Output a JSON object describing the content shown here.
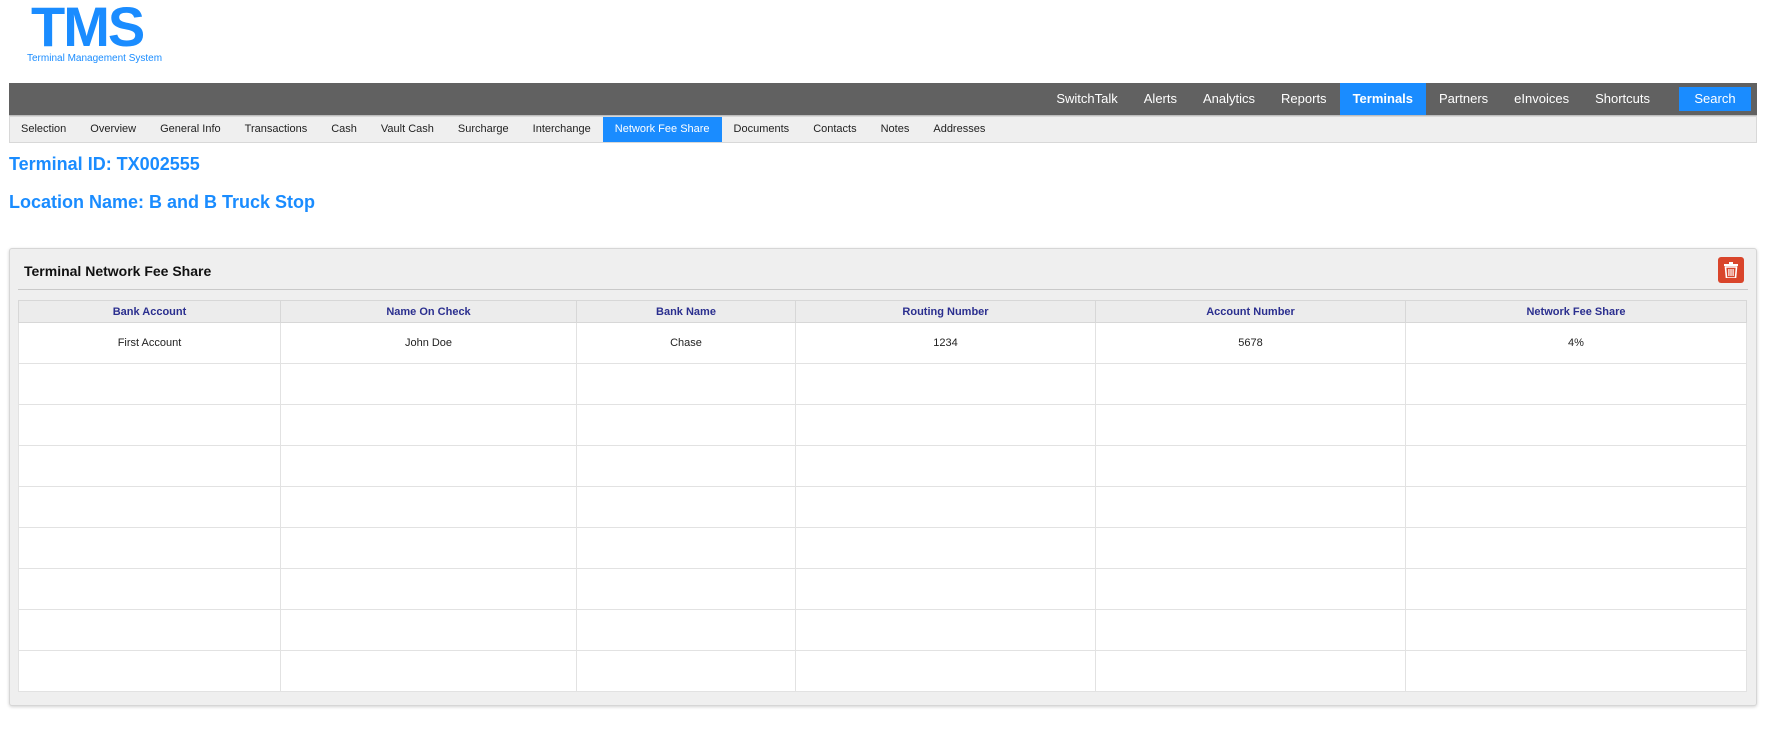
{
  "logo": {
    "mark": "TMS",
    "subtitle": "Terminal Management System"
  },
  "topnav": {
    "items": [
      {
        "label": "SwitchTalk",
        "active": false
      },
      {
        "label": "Alerts",
        "active": false
      },
      {
        "label": "Analytics",
        "active": false
      },
      {
        "label": "Reports",
        "active": false
      },
      {
        "label": "Terminals",
        "active": true
      },
      {
        "label": "Partners",
        "active": false
      },
      {
        "label": "eInvoices",
        "active": false
      },
      {
        "label": "Shortcuts",
        "active": false
      }
    ],
    "search_label": "Search"
  },
  "subnav": {
    "items": [
      {
        "label": "Selection",
        "active": false
      },
      {
        "label": "Overview",
        "active": false
      },
      {
        "label": "General Info",
        "active": false
      },
      {
        "label": "Transactions",
        "active": false
      },
      {
        "label": "Cash",
        "active": false
      },
      {
        "label": "Vault Cash",
        "active": false
      },
      {
        "label": "Surcharge",
        "active": false
      },
      {
        "label": "Interchange",
        "active": false
      },
      {
        "label": "Network Fee Share",
        "active": true
      },
      {
        "label": "Documents",
        "active": false
      },
      {
        "label": "Contacts",
        "active": false
      },
      {
        "label": "Notes",
        "active": false
      },
      {
        "label": "Addresses",
        "active": false
      }
    ]
  },
  "terminal": {
    "id_text": "Terminal ID: TX002555",
    "location_text": "Location Name: B and B Truck Stop"
  },
  "panel": {
    "title": "Terminal Network Fee Share",
    "delete_icon": "trash-icon",
    "columns": [
      "Bank Account",
      "Name On Check",
      "Bank Name",
      "Routing Number",
      "Account Number",
      "Network Fee Share"
    ],
    "rows": [
      [
        "First Account",
        "John Doe",
        "Chase",
        "1234",
        "5678",
        "4%"
      ],
      [
        "",
        "",
        "",
        "",
        "",
        ""
      ],
      [
        "",
        "",
        "",
        "",
        "",
        ""
      ],
      [
        "",
        "",
        "",
        "",
        "",
        ""
      ],
      [
        "",
        "",
        "",
        "",
        "",
        ""
      ],
      [
        "",
        "",
        "",
        "",
        "",
        ""
      ],
      [
        "",
        "",
        "",
        "",
        "",
        ""
      ],
      [
        "",
        "",
        "",
        "",
        "",
        ""
      ],
      [
        "",
        "",
        "",
        "",
        "",
        ""
      ]
    ]
  },
  "colors": {
    "accent": "#1a8cff",
    "nav_bg": "#616161",
    "delete": "#d9452b",
    "header_text": "#2b2f8f"
  }
}
